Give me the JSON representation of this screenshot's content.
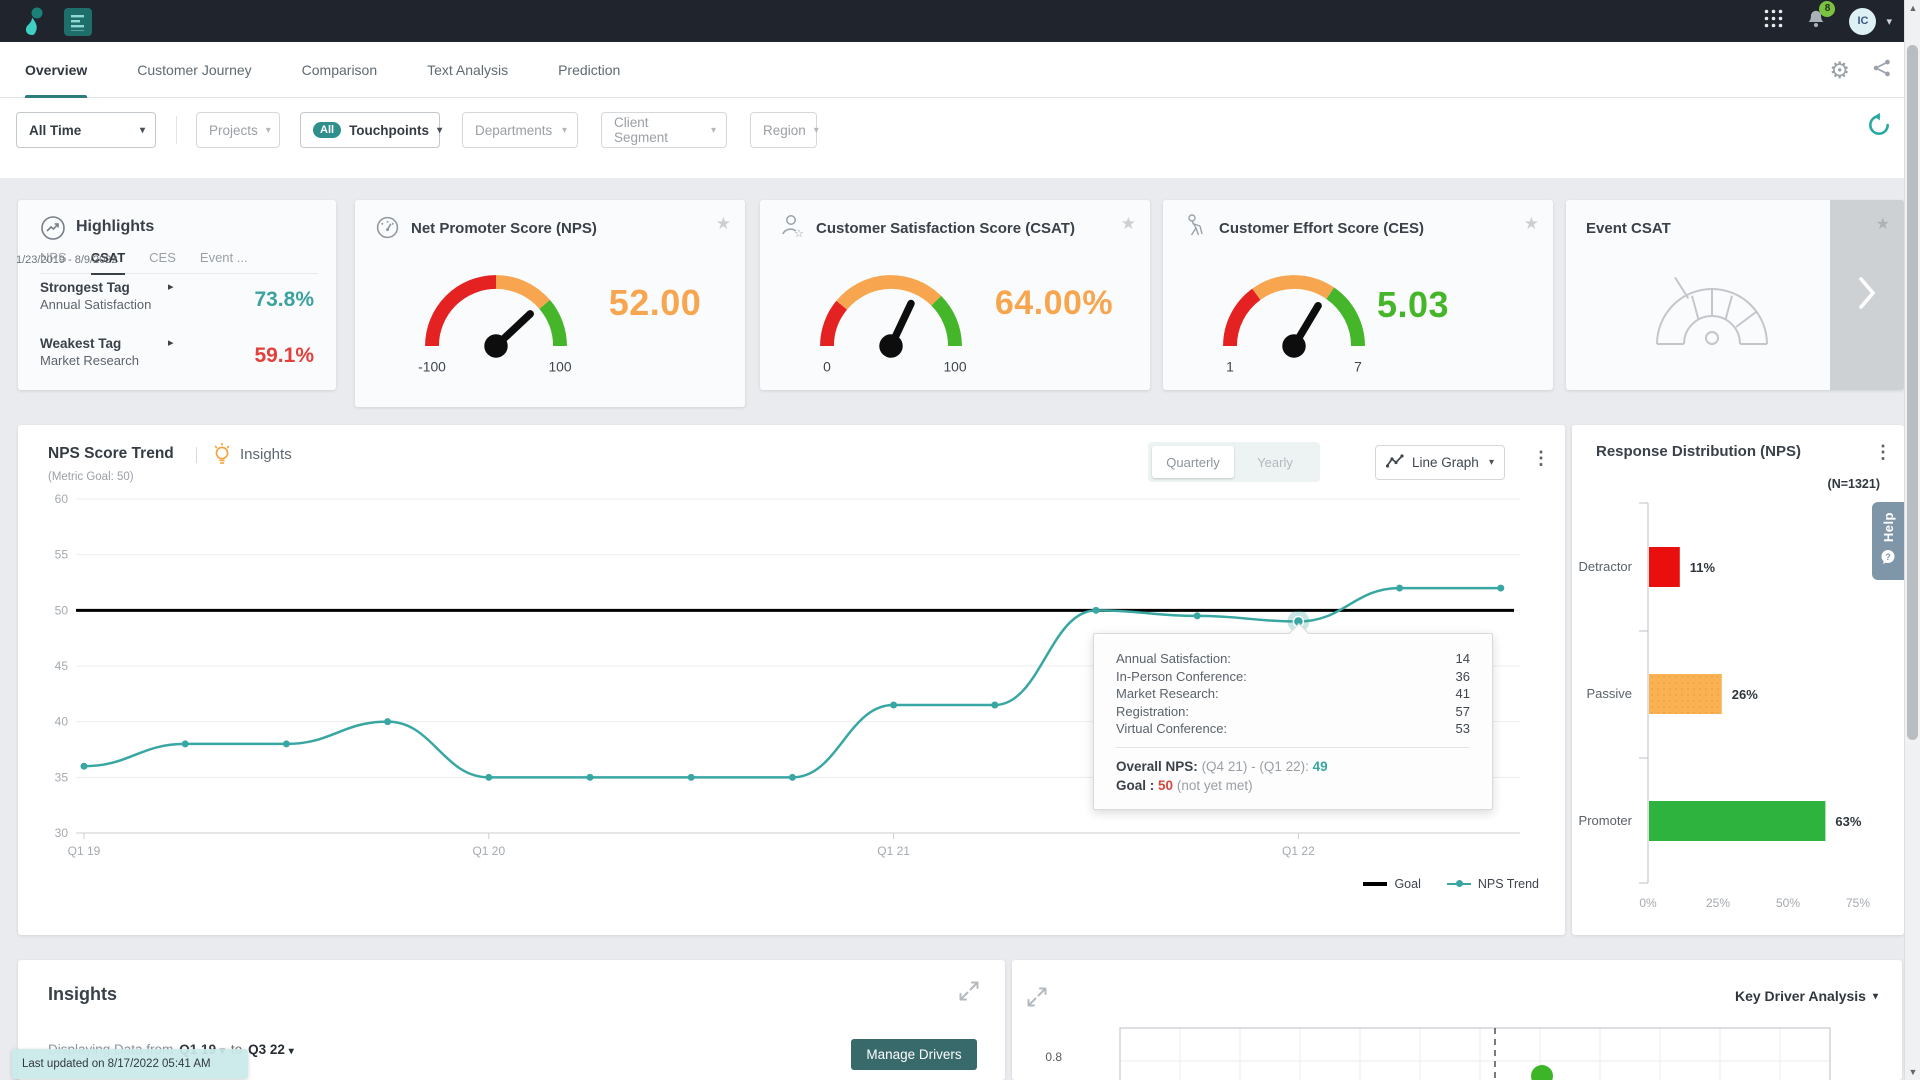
{
  "navbar": {
    "notification_count": "8",
    "avatar_initials": "IC"
  },
  "nav_tabs": [
    {
      "label": "Overview",
      "active": true
    },
    {
      "label": "Customer Journey",
      "active": false
    },
    {
      "label": "Comparison",
      "active": false
    },
    {
      "label": "Text Analysis",
      "active": false
    },
    {
      "label": "Prediction",
      "active": false
    }
  ],
  "filters": {
    "time_range": "All Time",
    "date_range": "1/23/2019 - 8/9/2022",
    "projects": "Projects",
    "touchpoints_badge": "All",
    "touchpoints": "Touchpoints",
    "departments": "Departments",
    "client_segment": "Client Segment",
    "region": "Region"
  },
  "highlights": {
    "title": "Highlights",
    "tabs": [
      "NPS",
      "CSAT",
      "CES",
      "Event ..."
    ],
    "active_tab": "CSAT",
    "strongest_label": "Strongest Tag",
    "strongest_tag": "Annual Satisfaction",
    "strongest_value": "73.8%",
    "strongest_color": "#3aa39f",
    "weakest_label": "Weakest Tag",
    "weakest_tag": "Market Research",
    "weakest_value": "59.1%",
    "weakest_color": "#e2403a"
  },
  "gauges": [
    {
      "title": "Net Promoter Score (NPS)",
      "value_text": "52.00",
      "value": 52,
      "min": -100,
      "max": 100,
      "min_label": "-100",
      "max_label": "100",
      "value_color": "#f7a64f",
      "segments": [
        {
          "from": -100,
          "to": 0,
          "color": "#e32221"
        },
        {
          "from": 0,
          "to": 55,
          "color": "#f7a64f"
        },
        {
          "from": 55,
          "to": 100,
          "color": "#45b52a"
        }
      ]
    },
    {
      "title": "Customer Satisfaction Score (CSAT)",
      "value_text": "64.00%",
      "value": 64,
      "min": 0,
      "max": 100,
      "min_label": "0",
      "max_label": "100",
      "value_color": "#f7a64f",
      "segments": [
        {
          "from": 0,
          "to": 22,
          "color": "#e32221"
        },
        {
          "from": 22,
          "to": 75,
          "color": "#f7a64f"
        },
        {
          "from": 75,
          "to": 100,
          "color": "#45b52a"
        }
      ]
    },
    {
      "title": "Customer Effort Score (CES)",
      "value_text": "5.03",
      "value": 5.03,
      "min": 1,
      "max": 7,
      "min_label": "1",
      "max_label": "7",
      "value_color": "#45b52a",
      "segments": [
        {
          "from": 1,
          "to": 2.8,
          "color": "#e32221"
        },
        {
          "from": 2.8,
          "to": 5.15,
          "color": "#f7a64f"
        },
        {
          "from": 5.15,
          "to": 7,
          "color": "#45b52a"
        }
      ]
    }
  ],
  "event_csat": {
    "title": "Event CSAT"
  },
  "trend_header": {
    "insights_label": "Insights",
    "toggle": [
      "Quarterly",
      "Yearly"
    ],
    "active_toggle": "Quarterly",
    "chart_type_label": "Line Graph"
  },
  "chart_data": [
    {
      "id": "nps_score_trend",
      "type": "line",
      "title": "NPS Score Trend",
      "subtitle": "(Metric Goal: 50)",
      "x": [
        "Q1 19",
        "Q2 19",
        "Q3 19",
        "Q4 19",
        "Q1 20",
        "Q2 20",
        "Q3 20",
        "Q4 20",
        "Q1 21",
        "Q2 21",
        "Q3 21",
        "Q4 21",
        "Q1 22",
        "Q2 22",
        "Q3 22"
      ],
      "x_shown_ticks": [
        "Q1 19",
        "Q1 20",
        "Q1 21",
        "Q1 22"
      ],
      "series": [
        {
          "name": "NPS Trend",
          "color": "#38a6a2",
          "values": [
            36,
            38,
            38,
            40,
            35,
            35,
            35,
            35,
            41.5,
            41.5,
            50,
            49.5,
            49,
            52,
            52
          ]
        },
        {
          "name": "Goal",
          "color": "#000000",
          "goal_value": 50
        }
      ],
      "ylim": [
        30,
        60
      ],
      "y_ticks": [
        30,
        35,
        40,
        45,
        50,
        55,
        60
      ],
      "selected_index": 12,
      "legend_position": "bottom-right",
      "grid": true
    },
    {
      "id": "response_distribution",
      "type": "bar",
      "title": "Response Distribution (NPS)",
      "n_label": "(N=1321)",
      "categories": [
        "Detractor",
        "Passive",
        "Promoter"
      ],
      "values": [
        11,
        26,
        63
      ],
      "value_labels": [
        "11%",
        "26%",
        "63%"
      ],
      "colors": [
        "#e90f0f",
        "#f9b152",
        "#2eb33e"
      ],
      "x_ticks": [
        "0%",
        "25%",
        "50%",
        "75%"
      ],
      "xlim": [
        0,
        83
      ],
      "orientation": "horizontal"
    },
    {
      "id": "key_driver_analysis",
      "type": "scatter",
      "title": "Key Driver Analysis",
      "visible_y_tick": "0.8",
      "visible_points": [
        {
          "color": "#3cb528"
        }
      ]
    }
  ],
  "trend_tooltip": {
    "rows": [
      {
        "label": "Annual Satisfaction:",
        "value": "14"
      },
      {
        "label": "In-Person Conference:",
        "value": "36"
      },
      {
        "label": "Market Research:",
        "value": "41"
      },
      {
        "label": "Registration:",
        "value": "57"
      },
      {
        "label": "Virtual Conference:",
        "value": "53"
      }
    ],
    "overall_label": "Overall NPS:",
    "overall_period": "(Q4 21) - (Q1 22):",
    "overall_value": "49",
    "goal_label": "Goal :",
    "goal_value": "50",
    "goal_status": "(not yet met)"
  },
  "insights_panel": {
    "title": "Insights",
    "displaying_prefix": "Displaying Data from",
    "from_value": "Q1 19",
    "to_word": "to",
    "to_value": "Q3 22",
    "manage_button": "Manage Drivers",
    "last_updated": "Last updated on 8/17/2022 05:41 AM"
  },
  "help_label": "Help",
  "colors": {
    "accent_teal": "#2e7d7a",
    "navbar_bg": "#20242c",
    "trend_line": "#38a6a2",
    "goal_line": "#000000"
  }
}
